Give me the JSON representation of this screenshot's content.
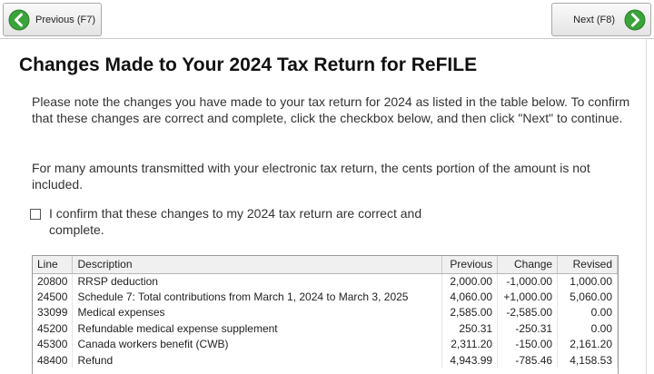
{
  "nav": {
    "previous_label": "Previous (F7)",
    "next_label": "Next (F8)",
    "accent_color": "#3aa33a"
  },
  "page": {
    "title": "Changes Made to Your 2024 Tax Return for ReFILE",
    "intro": "Please note the changes you have made to your tax return for 2024 as listed in the table below. To confirm that these changes are correct and complete, click the checkbox below, and then click \"Next\" to continue.",
    "cents_note": "For many amounts transmitted with your electronic tax return, the cents portion of the amount is not included."
  },
  "confirm": {
    "label": "I confirm that these changes to my 2024 tax return are correct and complete.",
    "checked": false
  },
  "table": {
    "headers": {
      "line": "Line",
      "description": "Description",
      "previous": "Previous",
      "change": "Change",
      "revised": "Revised"
    },
    "rows": [
      {
        "line": "20800",
        "description": "RRSP deduction",
        "previous": "2,000.00",
        "change": "-1,000.00",
        "revised": "1,000.00"
      },
      {
        "line": "24500",
        "description": "Schedule 7: Total contributions from March 1, 2024 to March 3, 2025",
        "previous": "4,060.00",
        "change": "+1,000.00",
        "revised": "5,060.00"
      },
      {
        "line": "33099",
        "description": "Medical expenses",
        "previous": "2,585.00",
        "change": "-2,585.00",
        "revised": "0.00"
      },
      {
        "line": "45200",
        "description": "Refundable medical expense supplement",
        "previous": "250.31",
        "change": "-250.31",
        "revised": "0.00"
      },
      {
        "line": "45300",
        "description": "Canada workers benefit (CWB)",
        "previous": "2,311.20",
        "change": "-150.00",
        "revised": "2,161.20"
      },
      {
        "line": "48400",
        "description": "Refund",
        "previous": "4,943.99",
        "change": "-785.46",
        "revised": "4,158.53"
      }
    ]
  }
}
